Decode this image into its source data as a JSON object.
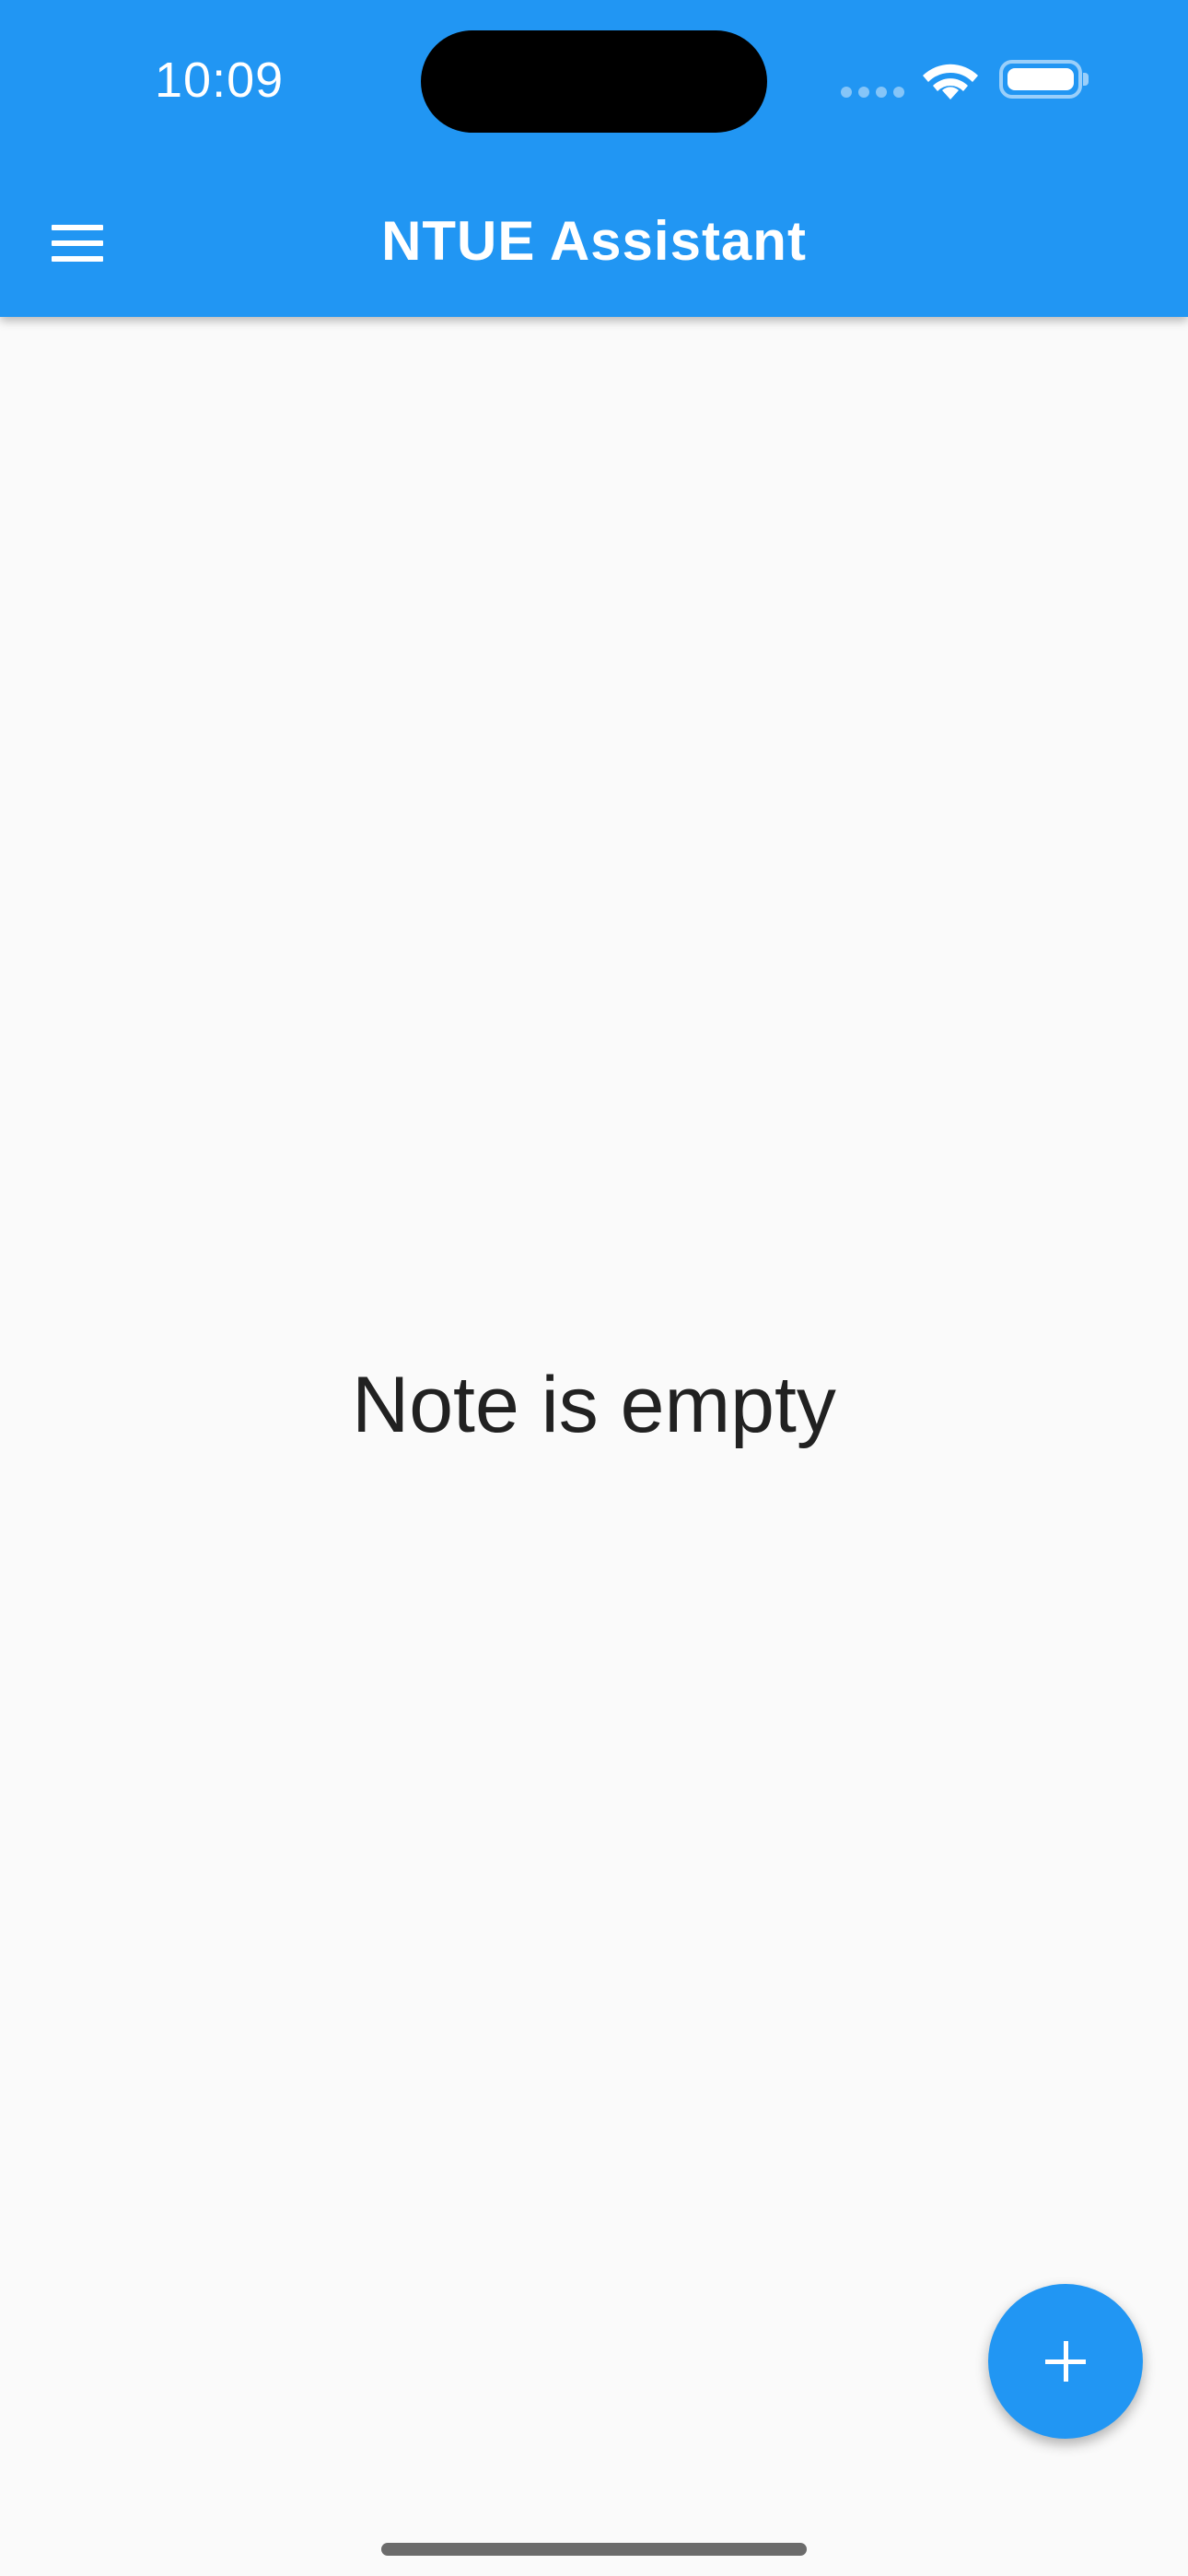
{
  "status_bar": {
    "time": "10:09"
  },
  "app_bar": {
    "title": "NTUE Assistant",
    "menu_icon": "hamburger-menu-icon"
  },
  "main": {
    "empty_message": "Note is empty"
  },
  "fab": {
    "icon": "plus-icon"
  },
  "colors": {
    "primary": "#2196f3",
    "background": "#fafafa",
    "text": "#212121",
    "on_primary": "#ffffff"
  }
}
